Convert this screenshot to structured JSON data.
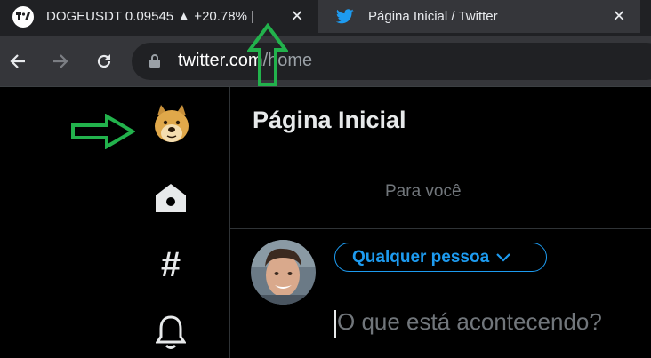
{
  "browser": {
    "tabs": [
      {
        "title": "DOGEUSDT 0.09545 ▲ +20.78% |",
        "icon": "tradingview-logo",
        "close": "✕"
      },
      {
        "title": "Página Inicial / Twitter",
        "icon": "twitter-bird",
        "close": "✕"
      }
    ],
    "url": {
      "host": "twitter.com",
      "path": "/home"
    },
    "nav": {
      "back": "back-arrow",
      "forward": "forward-arrow",
      "reload": "reload"
    }
  },
  "twitter": {
    "sidebar": [
      "doge-avatar",
      "home",
      "explore-hashtag",
      "notifications"
    ],
    "hashtag_glyph": "#",
    "page_title": "Página Inicial",
    "feed_tab": "Para você",
    "composer": {
      "audience_label": "Qualquer pessoa",
      "placeholder": "O que está acontecendo?"
    },
    "colors": {
      "accent": "#1d9bf0",
      "background": "#000000",
      "text": "#e7e9ea",
      "muted": "#71767b"
    }
  },
  "annotations": {
    "arrow_color": "#22b24c"
  }
}
